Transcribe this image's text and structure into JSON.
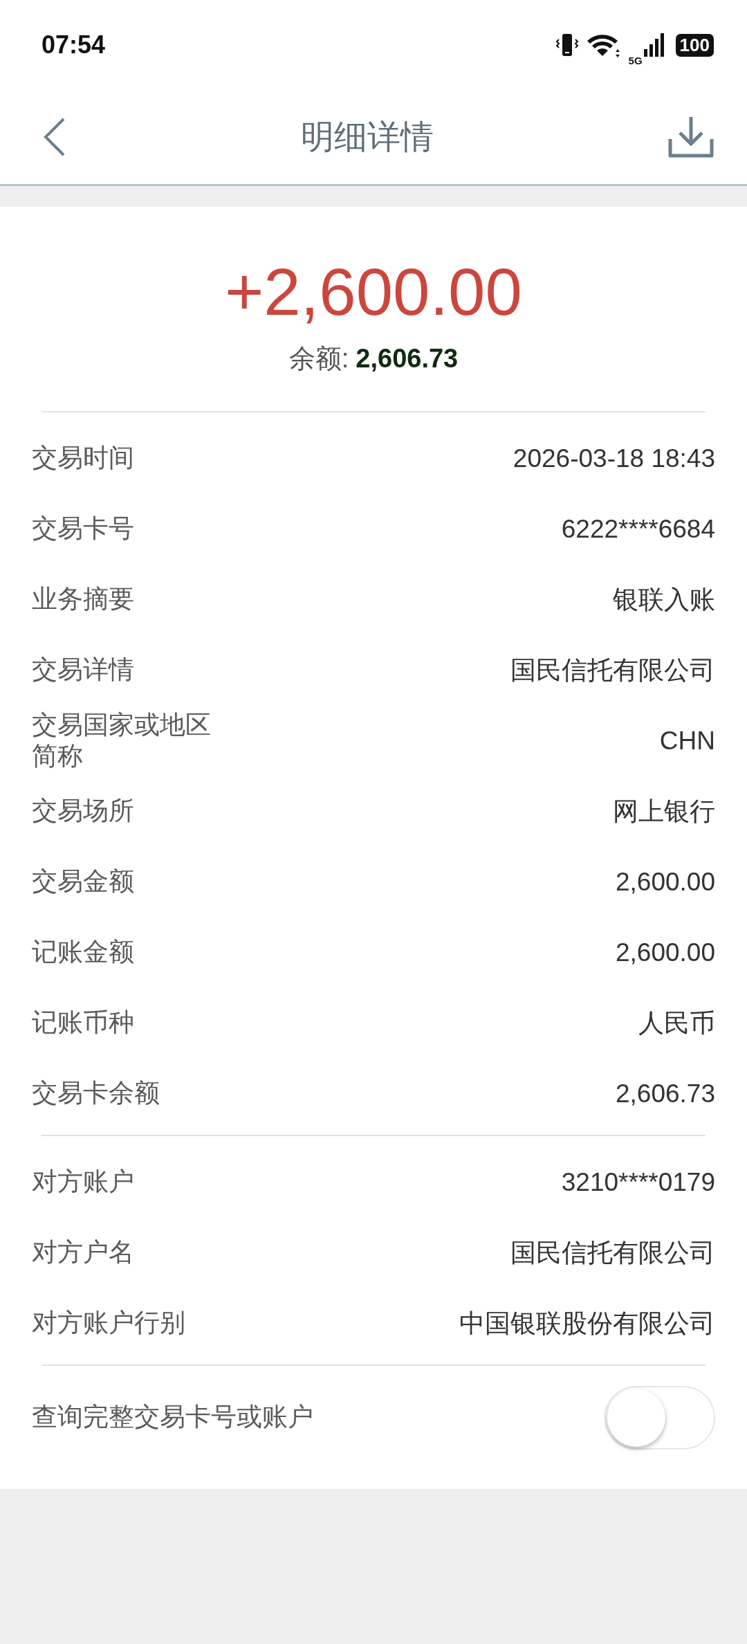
{
  "status_bar": {
    "time": "07:54",
    "battery": "100",
    "network": "5G"
  },
  "header": {
    "title": "明细详情"
  },
  "summary": {
    "amount": "+2,600.00",
    "balance_label": "余额:",
    "balance": "2,606.73"
  },
  "sections": [
    [
      {
        "label": "交易时间",
        "value": "2026-03-18 18:43"
      },
      {
        "label": "交易卡号",
        "value": "6222****6684"
      },
      {
        "label": "业务摘要",
        "value": "银联入账"
      },
      {
        "label": "交易详情",
        "value": "国民信托有限公司"
      },
      {
        "label": "交易国家或地区简称",
        "value": "CHN"
      },
      {
        "label": "交易场所",
        "value": "网上银行"
      },
      {
        "label": "交易金额",
        "value": "2,600.00"
      },
      {
        "label": "记账金额",
        "value": "2,600.00"
      },
      {
        "label": "记账币种",
        "value": "人民币"
      },
      {
        "label": "交易卡余额",
        "value": "2,606.73"
      }
    ],
    [
      {
        "label": "对方账户",
        "value": "3210****0179"
      },
      {
        "label": "对方户名",
        "value": "国民信托有限公司"
      },
      {
        "label": "对方账户行别",
        "value": "中国银联股份有限公司"
      }
    ]
  ],
  "toggle": {
    "label": "查询完整交易卡号或账户",
    "on": false
  }
}
